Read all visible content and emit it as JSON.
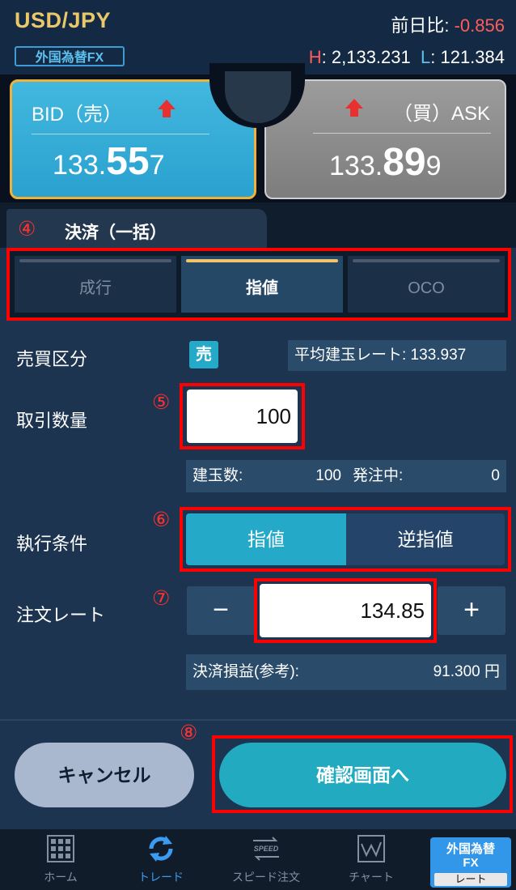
{
  "header": {
    "pair": "USD/JPY",
    "badge": "外国為替FX",
    "change_label": "前日比:",
    "change_value": "-0.856",
    "high_label": "H",
    "high_value": ": 2,133.231",
    "low_label": "L",
    "low_value": ": 121.384"
  },
  "bid": {
    "label": "BID（売）",
    "price_prefix": "133.",
    "price_main": "55",
    "price_suffix": "7"
  },
  "ask": {
    "label": "（買）ASK",
    "price_prefix": "133.",
    "price_main": "89",
    "price_suffix": "9"
  },
  "tab": {
    "number": "④",
    "label": "決済（一括）"
  },
  "order_types": [
    "成行",
    "指値",
    "OCO"
  ],
  "form": {
    "side_label": "売買区分",
    "side_value": "売",
    "avg_rate_text": "平均建玉レート: 133.937",
    "qty_number": "⑤",
    "qty_label": "取引数量",
    "qty_value": "100",
    "positions_label": "建玉数:",
    "positions_value": "100",
    "pending_label": "発注中:",
    "pending_value": "0",
    "cond_number": "⑥",
    "cond_label": "執行条件",
    "cond_options": [
      "指値",
      "逆指値"
    ],
    "rate_number": "⑦",
    "rate_label": "注文レート",
    "minus": "−",
    "plus": "+",
    "rate_value": "134.85",
    "pl_label": "決済損益(参考):",
    "pl_value": "91.300 円"
  },
  "actions": {
    "confirm_number": "⑧",
    "cancel": "キャンセル",
    "confirm": "確認画面へ"
  },
  "nav": {
    "items": [
      "ホーム",
      "トレード",
      "スピード注文",
      "チャート"
    ],
    "speed_text": "SPEED",
    "fx_line1": "外国為替",
    "fx_line2": "FX",
    "fx_rate": "レート"
  },
  "colors": {
    "accent": "#25a9c8",
    "highlight": "#ff0000",
    "negative": "#ff5c5c",
    "gold": "#e9c86a"
  }
}
